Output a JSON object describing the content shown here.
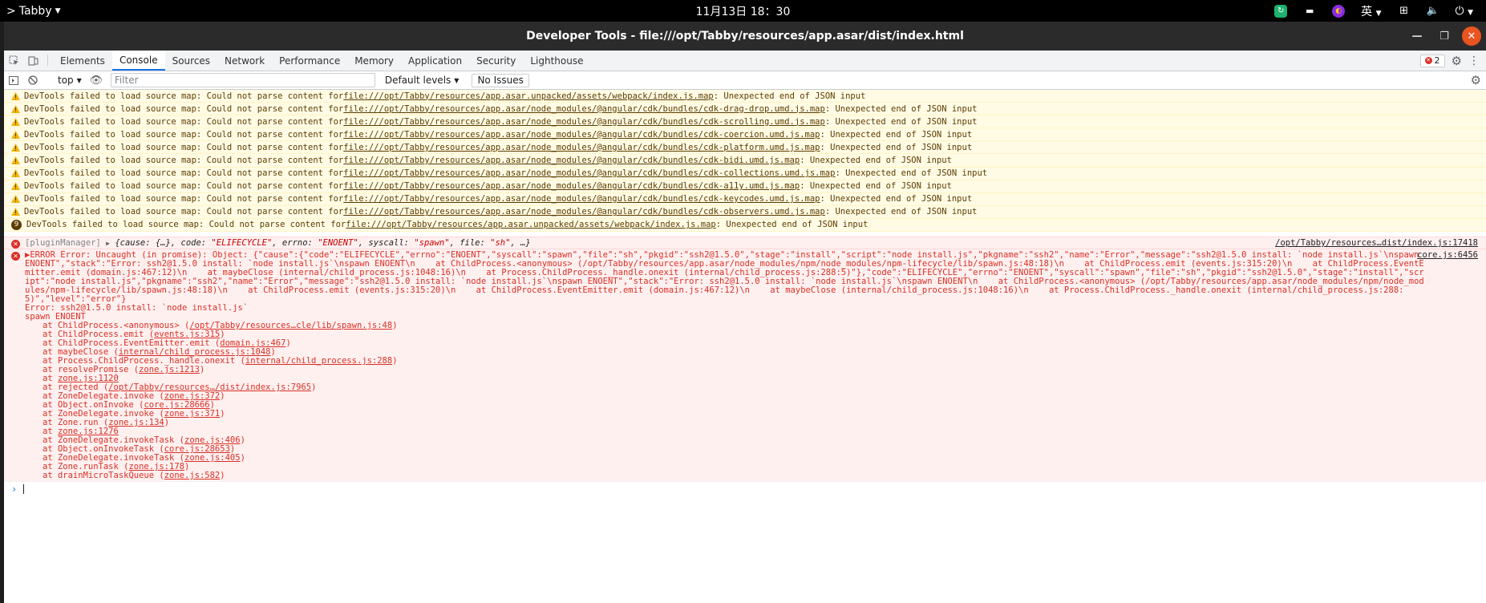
{
  "topbar": {
    "app_name": "Tabby",
    "clock": "11月13日  18：30",
    "ime": "英"
  },
  "window": {
    "title": "Developer Tools - file:///opt/Tabby/resources/app.asar/dist/index.html"
  },
  "tabs": [
    "Elements",
    "Console",
    "Sources",
    "Network",
    "Performance",
    "Memory",
    "Application",
    "Security",
    "Lighthouse"
  ],
  "error_count": "2",
  "toolbar": {
    "context": "top",
    "filter_placeholder": "Filter",
    "levels": "Default levels",
    "issues": "No Issues"
  },
  "warnings": [
    {
      "prefix": "DevTools failed to load source map: Could not parse content for ",
      "url": "file:///opt/Tabby/resources/app.asar.unpacked/assets/webpack/index.js.map",
      "suffix": ": Unexpected end of JSON input"
    },
    {
      "prefix": "DevTools failed to load source map: Could not parse content for ",
      "url": "file:///opt/Tabby/resources/app.asar/node_modules/@angular/cdk/bundles/cdk-drag-drop.umd.js.map",
      "suffix": ": Unexpected end of JSON input"
    },
    {
      "prefix": "DevTools failed to load source map: Could not parse content for ",
      "url": "file:///opt/Tabby/resources/app.asar/node_modules/@angular/cdk/bundles/cdk-scrolling.umd.js.map",
      "suffix": ": Unexpected end of JSON input"
    },
    {
      "prefix": "DevTools failed to load source map: Could not parse content for ",
      "url": "file:///opt/Tabby/resources/app.asar/node_modules/@angular/cdk/bundles/cdk-coercion.umd.js.map",
      "suffix": ": Unexpected end of JSON input"
    },
    {
      "prefix": "DevTools failed to load source map: Could not parse content for ",
      "url": "file:///opt/Tabby/resources/app.asar/node_modules/@angular/cdk/bundles/cdk-platform.umd.js.map",
      "suffix": ": Unexpected end of JSON input"
    },
    {
      "prefix": "DevTools failed to load source map: Could not parse content for ",
      "url": "file:///opt/Tabby/resources/app.asar/node_modules/@angular/cdk/bundles/cdk-bidi.umd.js.map",
      "suffix": ": Unexpected end of JSON input"
    },
    {
      "prefix": "DevTools failed to load source map: Could not parse content for ",
      "url": "file:///opt/Tabby/resources/app.asar/node_modules/@angular/cdk/bundles/cdk-collections.umd.js.map",
      "suffix": ": Unexpected end of JSON input"
    },
    {
      "prefix": "DevTools failed to load source map: Could not parse content for ",
      "url": "file:///opt/Tabby/resources/app.asar/node_modules/@angular/cdk/bundles/cdk-a11y.umd.js.map",
      "suffix": ": Unexpected end of JSON input"
    },
    {
      "prefix": "DevTools failed to load source map: Could not parse content for ",
      "url": "file:///opt/Tabby/resources/app.asar/node_modules/@angular/cdk/bundles/cdk-keycodes.umd.js.map",
      "suffix": ": Unexpected end of JSON input"
    },
    {
      "prefix": "DevTools failed to load source map: Could not parse content for ",
      "url": "file:///opt/Tabby/resources/app.asar/node_modules/@angular/cdk/bundles/cdk-observers.umd.js.map",
      "suffix": ": Unexpected end of JSON input"
    }
  ],
  "repeated_warning": {
    "count": "9",
    "prefix": "DevTools failed to load source map: Could not parse content for ",
    "url": "file:///opt/Tabby/resources/app.asar.unpacked/assets/webpack/index.js.map",
    "suffix": ": Unexpected end of JSON input"
  },
  "plugin_error": {
    "prefix": "[pluginManager]",
    "toggle": "▶",
    "text_1": "{cause: {…}, code: ",
    "code": "\"ELIFECYCLE\"",
    "text_2": ", errno: ",
    "errno": "\"ENOENT\"",
    "text_3": ", syscall: ",
    "syscall": "\"spawn\"",
    "text_4": ", file: ",
    "file": "\"sh\"",
    "text_5": ", …}",
    "source": "/opt/Tabby/resources…dist/index.js:17418"
  },
  "main_error": {
    "source": "core.js:6456",
    "header": "▶ERROR Error: Uncaught (in promise): Object: {\"cause\":{\"code\":\"ELIFECYCLE\",\"errno\":\"ENOENT\",\"syscall\":\"spawn\",\"file\":\"sh\",\"pkgid\":\"ssh2@1.5.0\",\"stage\":\"install\",\"script\":\"node install.js\",\"pkgname\":\"ssh2\",\"name\":\"Error\",\"message\":\"ssh2@1.5.0 install: `node install.js`\\nspawn ENOENT\",\"stack\":\"Error: ssh2@1.5.0 install: `node install.js`\\nspawn ENOENT\\n    at ChildProcess.<anonymous> (/opt/Tabby/resources/app.asar/node_modules/npm/node_modules/npm-lifecycle/lib/spawn.js:48:18)\\n    at ChildProcess.emit (events.js:315:20)\\n    at ChildProcess.EventEmitter.emit (domain.js:467:12)\\n    at maybeClose (internal/child_process.js:1048:16)\\n    at Process.ChildProcess._handle.onexit (internal/child_process.js:288:5)\"},\"code\":\"ELIFECYCLE\",\"errno\":\"ENOENT\",\"syscall\":\"spawn\",\"file\":\"sh\",\"pkgid\":\"ssh2@1.5.0\",\"stage\":\"install\",\"script\":\"node install.js\",\"pkgname\":\"ssh2\",\"name\":\"Error\",\"message\":\"ssh2@1.5.0 install: `node install.js`\\nspawn ENOENT\",\"stack\":\"Error: ssh2@1.5.0 install: `node install.js`\\nspawn ENOENT\\n    at ChildProcess.<anonymous> (/opt/Tabby/resources/app.asar/node_modules/npm/node_modules/npm-lifecycle/lib/spawn.js:48:18)\\n    at ChildProcess.emit (events.js:315:20)\\n    at ChildProcess.EventEmitter.emit (domain.js:467:12)\\n    at maybeClose (internal/child_process.js:1048:16)\\n    at Process.ChildProcess._handle.onexit (internal/child_process.js:288:5)\",\"level\":\"error\"}",
    "line_error": "Error: ssh2@1.5.0 install: `node install.js`",
    "line_spawn": "spawn ENOENT",
    "stack": [
      {
        "pre": "at ChildProcess.<anonymous> (",
        "link": "/opt/Tabby/resources…cle/lib/spawn.js:48",
        "post": ")"
      },
      {
        "pre": "at ChildProcess.emit (",
        "link": "events.js:315",
        "post": ")"
      },
      {
        "pre": "at ChildProcess.EventEmitter.emit (",
        "link": "domain.js:467",
        "post": ")"
      },
      {
        "pre": "at maybeClose (",
        "link": "internal/child_process.js:1048",
        "post": ")"
      },
      {
        "pre": "at Process.ChildProcess._handle.onexit (",
        "link": "internal/child_process.js:288",
        "post": ")"
      },
      {
        "pre": "at resolvePromise (",
        "link": "zone.js:1213",
        "post": ")"
      },
      {
        "pre": "at ",
        "link": "zone.js:1120",
        "post": ""
      },
      {
        "pre": "at rejected (",
        "link": "/opt/Tabby/resources…/dist/index.js:7965",
        "post": ")"
      },
      {
        "pre": "at ZoneDelegate.invoke (",
        "link": "zone.js:372",
        "post": ")"
      },
      {
        "pre": "at Object.onInvoke (",
        "link": "core.js:28666",
        "post": ")"
      },
      {
        "pre": "at ZoneDelegate.invoke (",
        "link": "zone.js:371",
        "post": ")"
      },
      {
        "pre": "at Zone.run (",
        "link": "zone.js:134",
        "post": ")"
      },
      {
        "pre": "at ",
        "link": "zone.js:1276",
        "post": ""
      },
      {
        "pre": "at ZoneDelegate.invokeTask (",
        "link": "zone.js:406",
        "post": ")"
      },
      {
        "pre": "at Object.onInvokeTask (",
        "link": "core.js:28653",
        "post": ")"
      },
      {
        "pre": "at ZoneDelegate.invokeTask (",
        "link": "zone.js:405",
        "post": ")"
      },
      {
        "pre": "at Zone.runTask (",
        "link": "zone.js:178",
        "post": ")"
      },
      {
        "pre": "at drainMicroTaskQueue (",
        "link": "zone.js:582",
        "post": ")"
      }
    ]
  },
  "colors": {
    "accent": "#1a73e8",
    "error": "#d93025",
    "warning_bg": "#fffbe5",
    "error_bg": "#fff0f0",
    "ubuntu_close": "#e95420"
  }
}
